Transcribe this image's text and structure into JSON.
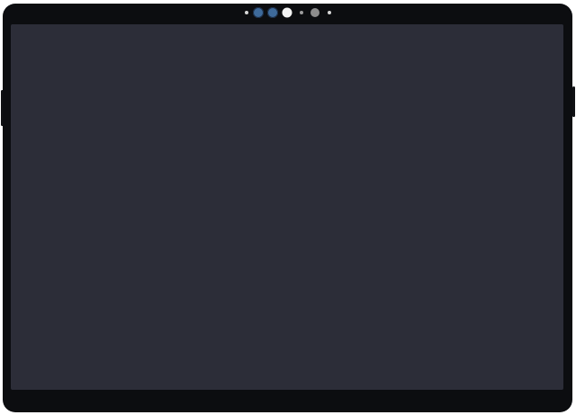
{
  "device": {
    "colors": {
      "bezel": "#0c0d10",
      "screen": "#2c2d38",
      "camera_lens": "#3e6a9b",
      "light_sensor": "#f4f4f4",
      "sensor_grey": "#8d8d8d"
    },
    "sensors": [
      {
        "icon": "sensor-dot-icon"
      },
      {
        "icon": "camera-lens-icon"
      },
      {
        "icon": "camera-lens-icon"
      },
      {
        "icon": "light-sensor-icon"
      },
      {
        "icon": "sensor-dot-icon"
      },
      {
        "icon": "proximity-sensor-icon"
      },
      {
        "icon": "sensor-dot-icon"
      }
    ]
  }
}
